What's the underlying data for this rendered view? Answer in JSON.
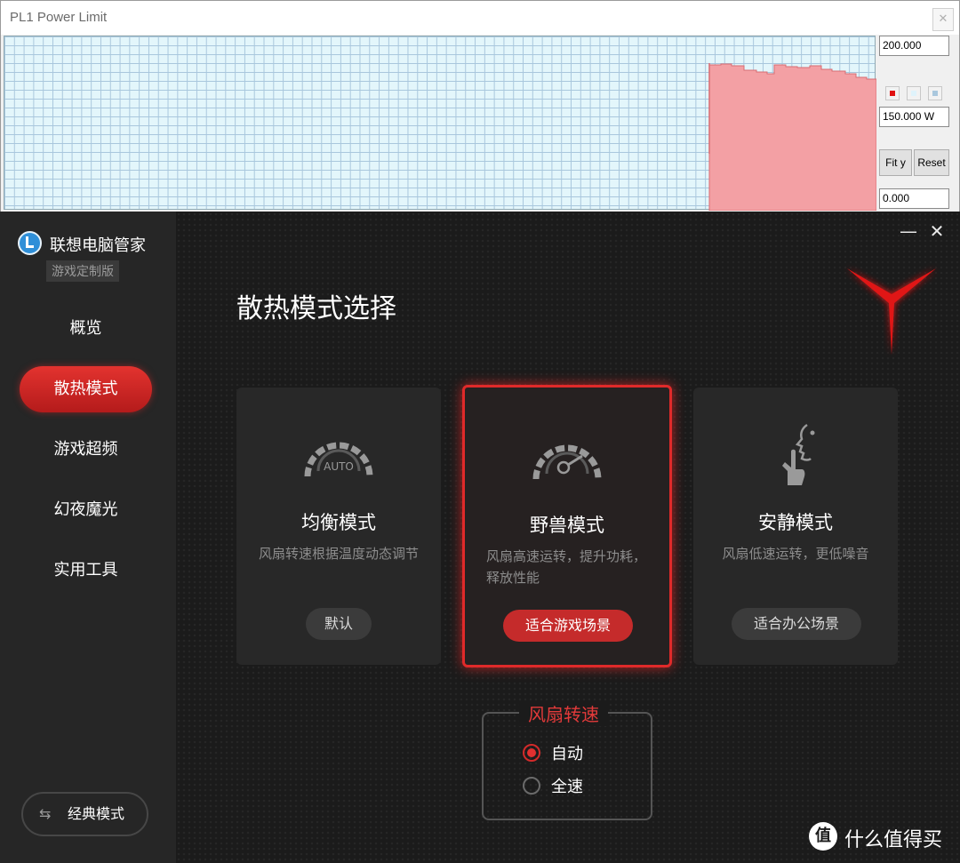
{
  "monitor": {
    "title": "PL1 Power Limit",
    "close_glyph": "✕",
    "ymax": "200.000",
    "current": "150.000 W",
    "ymin": "0.000",
    "fit_label": "Fit y",
    "reset_label": "Reset",
    "toggle_colors": [
      "#e01010",
      "#dff3fb",
      "#a9c7dd"
    ],
    "plot_colors": {
      "background": "#e3f6fb",
      "grid": "#a9c7dd",
      "area": "#f3a0a4"
    }
  },
  "sidebar": {
    "app_name": "联想电脑管家",
    "edition": "游戏定制版",
    "nav": [
      {
        "label": "概览",
        "active": false
      },
      {
        "label": "散热模式",
        "active": true
      },
      {
        "label": "游戏超频",
        "active": false
      },
      {
        "label": "幻夜魔光",
        "active": false
      },
      {
        "label": "实用工具",
        "active": false
      }
    ],
    "classic_mode_label": "经典模式",
    "classic_icon": "swap-arrows-icon"
  },
  "window": {
    "minimize_glyph": "—",
    "close_glyph": "✕"
  },
  "main": {
    "title": "散热模式选择",
    "cards": [
      {
        "title": "均衡模式",
        "desc": "风扇转速根据温度动态调节",
        "tag": "默认",
        "icon": "auto-gauge-icon",
        "icon_text": "AUTO",
        "selected": false
      },
      {
        "title": "野兽模式",
        "desc": "风扇高速运转，提升功耗，释放性能",
        "tag": "适合游戏场景",
        "icon": "speedometer-icon",
        "selected": true
      },
      {
        "title": "安静模式",
        "desc": "风扇低速运转，更低噪音",
        "tag": "适合办公场景",
        "icon": "quiet-gesture-icon",
        "selected": false
      }
    ],
    "fan": {
      "title": "风扇转速",
      "options": [
        {
          "label": "自动",
          "checked": true
        },
        {
          "label": "全速",
          "checked": false
        }
      ]
    }
  },
  "watermark": {
    "icon_text": "值",
    "text": "什么值得买"
  },
  "colors": {
    "accent": "#e02a2a",
    "sidebar_bg": "#262626",
    "main_bg": "#1b1b1b",
    "card_bg": "#282828"
  }
}
